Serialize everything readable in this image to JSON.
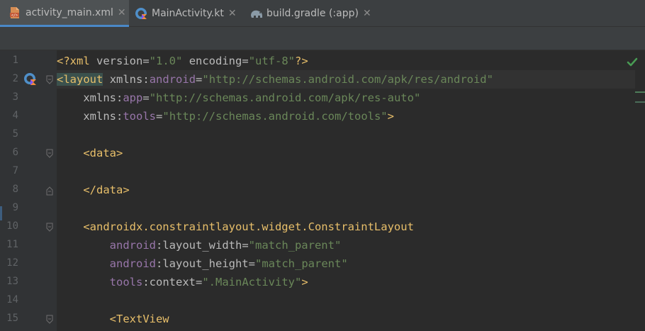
{
  "tabs": [
    {
      "label": "activity_main.xml",
      "icon": "xml-file-icon",
      "active": true
    },
    {
      "label": "MainActivity.kt",
      "icon": "kotlin-file-icon",
      "active": false
    },
    {
      "label": "build.gradle (:app)",
      "icon": "gradle-elephant-icon",
      "active": false
    }
  ],
  "tab_close": "✕",
  "lines": [
    {
      "number": "1"
    },
    {
      "number": "2"
    },
    {
      "number": "3"
    },
    {
      "number": "4"
    },
    {
      "number": "5"
    },
    {
      "number": "6"
    },
    {
      "number": "7"
    },
    {
      "number": "8"
    },
    {
      "number": "9"
    },
    {
      "number": "10"
    },
    {
      "number": "11"
    },
    {
      "number": "12"
    },
    {
      "number": "13"
    },
    {
      "number": "14"
    },
    {
      "number": "15"
    }
  ],
  "code": {
    "l1": {
      "open": "<?xml ",
      "a1": "version",
      "eq1": "=",
      "v1": "\"1.0\"",
      "sp": " ",
      "a2": "encoding",
      "eq2": "=",
      "v2": "\"utf-8\"",
      "close": "?>"
    },
    "l2": {
      "lt": "<",
      "tag": "layout",
      "sp": " ",
      "attr": "xmlns",
      "colon": ":",
      "ns": "android",
      "eq": "=",
      "val": "\"http://schemas.android.com/apk/res/android\""
    },
    "l3": {
      "indent": "    ",
      "attr": "xmlns",
      "colon": ":",
      "ns": "app",
      "eq": "=",
      "val": "\"http://schemas.android.com/apk/res-auto\""
    },
    "l4": {
      "indent": "    ",
      "attr": "xmlns",
      "colon": ":",
      "ns": "tools",
      "eq": "=",
      "val": "\"http://schemas.android.com/tools\"",
      "gt": ">"
    },
    "l6": {
      "indent": "    ",
      "text": "<data>"
    },
    "l8": {
      "indent": "    ",
      "text": "</data>"
    },
    "l10": {
      "indent": "    ",
      "text": "<androidx.constraintlayout.widget.ConstraintLayout"
    },
    "l11": {
      "indent": "        ",
      "ns": "android",
      "colon": ":",
      "attr": "layout_width",
      "eq": "=",
      "val": "\"match_parent\""
    },
    "l12": {
      "indent": "        ",
      "ns": "android",
      "colon": ":",
      "attr": "layout_height",
      "eq": "=",
      "val": "\"match_parent\""
    },
    "l13": {
      "indent": "        ",
      "ns": "tools",
      "colon": ":",
      "attr": "context",
      "eq": "=",
      "val": "\".MainActivity\"",
      "gt": ">"
    },
    "l15": {
      "indent": "        ",
      "text": "<TextView"
    }
  },
  "colors": {
    "tab_active_underline": "#4a88c7",
    "tag": "#e8bf6a",
    "namespace": "#9876aa",
    "string": "#6a8759",
    "attribute": "#bababa",
    "background": "#2b2b2b",
    "gutter": "#313335"
  },
  "status": {
    "inspection_icon": "check-icon"
  }
}
